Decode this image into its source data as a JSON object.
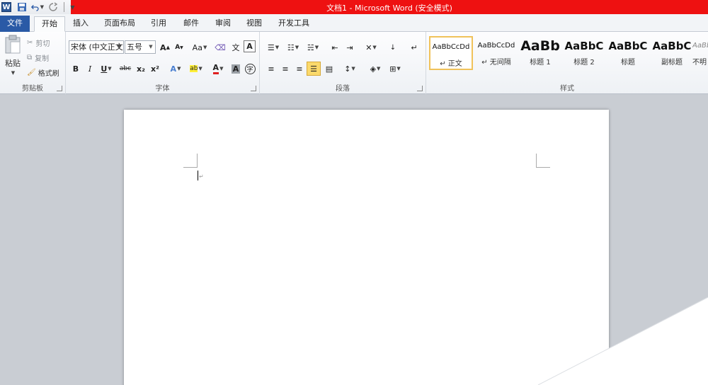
{
  "window": {
    "title": "文档1 - Microsoft Word (安全模式)",
    "qat": {
      "app_icon": "W"
    }
  },
  "tabs": [
    {
      "label": "文件"
    },
    {
      "label": "开始"
    },
    {
      "label": "插入"
    },
    {
      "label": "页面布局"
    },
    {
      "label": "引用"
    },
    {
      "label": "邮件"
    },
    {
      "label": "审阅"
    },
    {
      "label": "视图"
    },
    {
      "label": "开发工具"
    }
  ],
  "clipboard": {
    "group_label": "剪贴板",
    "paste": "粘贴",
    "cut": "剪切",
    "copy": "复制",
    "format_painter": "格式刷"
  },
  "font": {
    "group_label": "字体",
    "font_name": "宋体 (中文正文)",
    "font_size": "五号",
    "grow": "A",
    "shrink": "A",
    "change_case": "Aa",
    "wen": "文",
    "bold": "B",
    "italic": "I",
    "underline": "U",
    "strike": "abc",
    "subscript": "x₂",
    "superscript": "x²",
    "effects": "A",
    "highlight": "ab",
    "font_color": "A",
    "char_shade": "A",
    "enclose": "字"
  },
  "paragraph": {
    "group_label": "段落"
  },
  "styles": {
    "group_label": "样式",
    "items": [
      {
        "sample": "AaBbCcDd",
        "name": "↵ 正文"
      },
      {
        "sample": "AaBbCcDd",
        "name": "↵ 无间隔"
      },
      {
        "sample": "AaBb",
        "name": "标题 1"
      },
      {
        "sample": "AaBbC",
        "name": "标题 2"
      },
      {
        "sample": "AaBbC",
        "name": "标题"
      },
      {
        "sample": "AaBbC",
        "name": "副标题"
      },
      {
        "sample": "AaBbC",
        "name": "不明"
      }
    ]
  },
  "document": {
    "paragraph_mark": "↵"
  },
  "colors": {
    "title_bar": "#ee1111",
    "file_tab": "#2a5aa6",
    "highlight": "#fbd96b"
  }
}
